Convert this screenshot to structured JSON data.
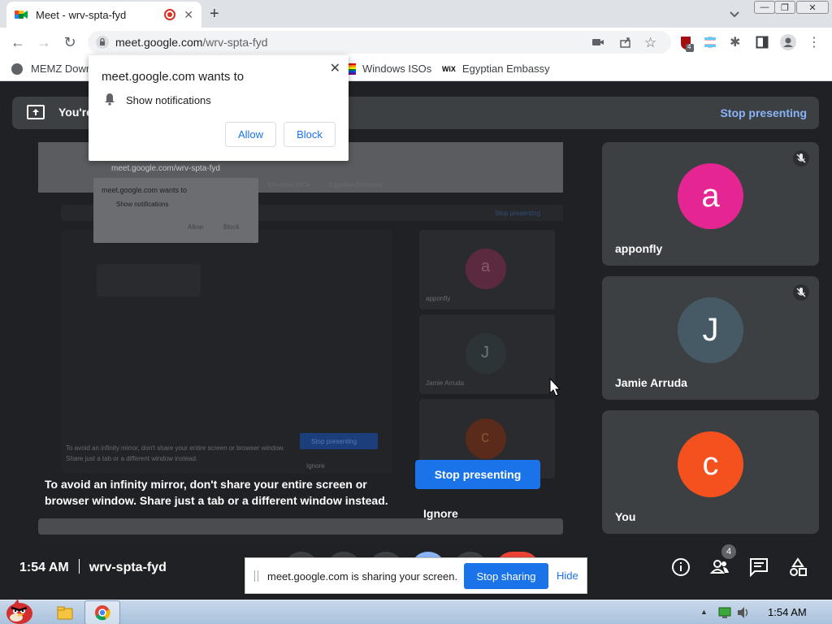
{
  "browser": {
    "tab_title": "Meet - wrv-spta-fyd",
    "url_domain": "meet.google.com",
    "url_path": "/wrv-spta-fyd",
    "extension_badge": "4"
  },
  "bookmarks": [
    "MEMZ Down",
    "Windows ISOs",
    "Egyptian Embassy"
  ],
  "notification": {
    "heading": "meet.google.com wants to",
    "permission": "Show notifications",
    "allow_label": "Allow",
    "block_label": "Block"
  },
  "banner": {
    "text": "You're",
    "stop_label": "Stop presenting"
  },
  "presentation": {
    "warning": "To avoid an infinity mirror, don't share your entire screen or browser window. Share just a tab or a different window instead.",
    "stop_label": "Stop presenting",
    "ignore_label": "Ignore"
  },
  "participants": [
    {
      "initial": "a",
      "name": "apponfly",
      "color": "#e52592",
      "muted": true
    },
    {
      "initial": "J",
      "name": "Jamie Arruda",
      "color": "#455a64",
      "muted": true
    },
    {
      "initial": "c",
      "name": "You",
      "color": "#f4511e",
      "muted": false
    }
  ],
  "meeting": {
    "time": "1:54 AM",
    "code": "wrv-spta-fyd",
    "people_count": "4"
  },
  "sharebar": {
    "message": "meet.google.com is sharing your screen.",
    "stop_label": "Stop sharing",
    "hide_label": "Hide"
  },
  "taskbar": {
    "clock": "1:54 AM"
  },
  "mirror": {
    "url": "meet.google.com/wrv-spta-fyd",
    "bookmark_1": "Windows ISOs",
    "bookmark_2": "Egyptian Embassy",
    "popup_heading": "meet.google.com wants to",
    "popup_perm": "Show notifications",
    "allow": "Allow",
    "block": "Block",
    "stop_presenting": "Stop presenting",
    "names": [
      "apponfly",
      "Jamie Arruda"
    ],
    "initials": [
      "a",
      "J",
      "c"
    ],
    "warning": "To avoid an infinity mirror, don't share your entire screen or browser window. Share just a tab or a different window instead.",
    "ignore": "Ignore"
  }
}
